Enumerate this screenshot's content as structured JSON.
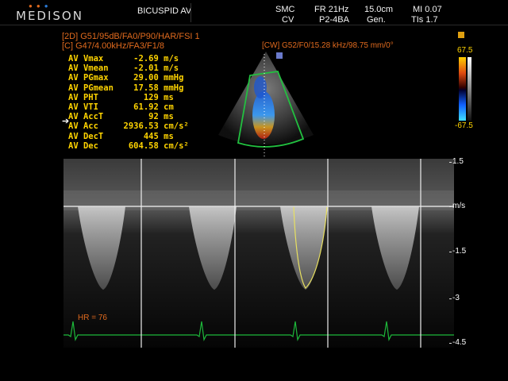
{
  "header": {
    "brand": "MEDISON",
    "exam_label": "BICUSPID AV",
    "site": "SMC",
    "mode": "CV",
    "frame_rate": "FR 21Hz",
    "probe": "P2-4BA",
    "depth": "15.0cm",
    "preset": "Gen.",
    "mi": "MI 0.07",
    "tis": "TIs 1.7"
  },
  "params": {
    "line1": "[2D] G51/95dB/FA0/P90/HAR/FSI 1",
    "line2": "[C] G47/4.00kHz/FA3/F1/8",
    "cw": "[CW] G52/F0/15.28 kHz/98.75 mm/0°"
  },
  "measurements": [
    {
      "name": "AV Vmax",
      "value": "-2.69",
      "unit": "m/s"
    },
    {
      "name": "AV Vmean",
      "value": "-2.01",
      "unit": "m/s"
    },
    {
      "name": "AV PGmax",
      "value": "29.00",
      "unit": "mmHg"
    },
    {
      "name": "AV PGmean",
      "value": "17.58",
      "unit": "mmHg"
    },
    {
      "name": "AV PHT",
      "value": "129",
      "unit": "ms"
    },
    {
      "name": "AV VTI",
      "value": "61.92",
      "unit": "cm"
    },
    {
      "name": "AV AccT",
      "value": "92",
      "unit": "ms"
    },
    {
      "name": "AV Acc",
      "value": "2936.53",
      "unit": "cm/s²"
    },
    {
      "name": "AV DecT",
      "value": "445",
      "unit": "ms"
    },
    {
      "name": "AV Dec",
      "value": "604.58",
      "unit": "cm/s²"
    }
  ],
  "color_scale": {
    "top": "67.5",
    "bottom": "-67.5"
  },
  "velocity_axis": {
    "ticks": [
      "1.5",
      "m/s",
      "-1.5",
      "-3",
      "-4.5"
    ]
  },
  "hr": "HR = 76",
  "colors": {
    "accent_orange": "#e06a1e",
    "meas_yellow": "#ffd400",
    "sector_green": "#22c040",
    "ecg_green": "#1db83a"
  }
}
